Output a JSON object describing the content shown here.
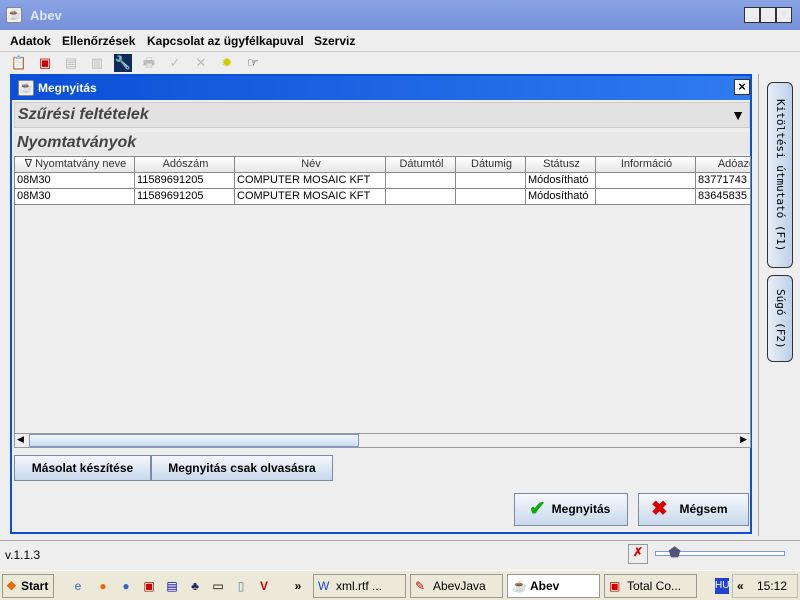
{
  "window": {
    "title": "Abev",
    "controls": [
      "_",
      "□",
      "×"
    ]
  },
  "menu": [
    "Adatok",
    "Ellenőrzések",
    "Kapcsolat az ügyfélkapuval",
    "Szerviz"
  ],
  "toolbar": [
    "open-icon",
    "save-export-icon",
    "disabled-icon",
    "disabled-icon",
    "tools-icon",
    "print-icon",
    "check-icon",
    "delete-icon",
    "gear-icon",
    "pointer-icon"
  ],
  "dialog": {
    "title": "Megnyitás",
    "close": "×",
    "filter_title": "Szűrési feltételek",
    "list_title": "Nyomtatványok",
    "columns": [
      "∇ Nyomtatvány neve",
      "Adószám",
      "Név",
      "Dátumtól",
      "Dátumig",
      "Státusz",
      "Információ",
      "Adóazo"
    ],
    "rows": [
      [
        "08M30",
        "11589691205",
        "COMPUTER MOSAIC KFT",
        "",
        "",
        "Módosítható",
        "",
        "83771743"
      ],
      [
        "08M30",
        "11589691205",
        "COMPUTER MOSAIC KFT",
        "",
        "",
        "Módosítható",
        "",
        "83645835"
      ]
    ],
    "copy_button": "Másolat készítése",
    "readonly_button": "Megnyitás csak olvasásra",
    "open_button": "Megnyitás",
    "cancel_button": "Mégsem"
  },
  "side_tabs": [
    "Kitöltési útmutató (F1)",
    "Súgó (F2)"
  ],
  "status": {
    "version": "v.1.1.3",
    "zoom_slider_percent": 15
  },
  "taskbar": {
    "start": "Start",
    "tasks": [
      "xml.rtf ...",
      "AbevJava",
      "Abev",
      "Total Co..."
    ],
    "lang": "HU",
    "clock": "15:12",
    "chevron": "»",
    "tray_chevron": "«"
  }
}
